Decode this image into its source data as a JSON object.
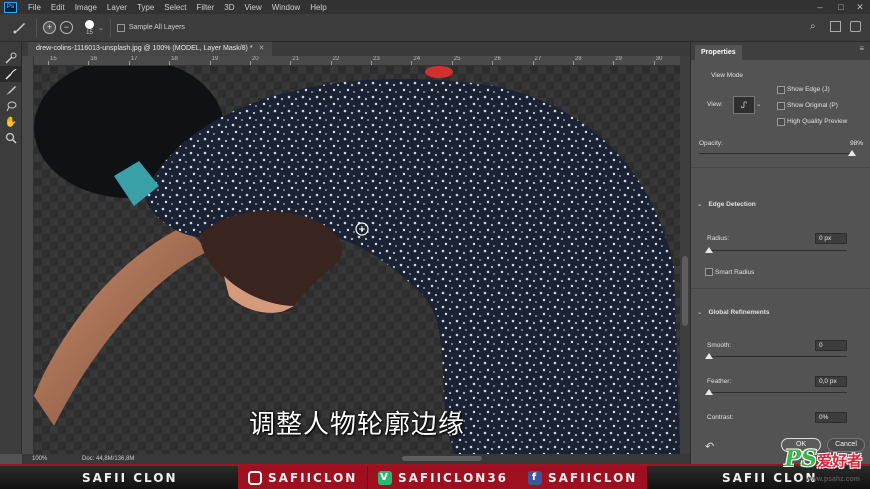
{
  "app": {
    "logo": "Ps"
  },
  "menu": [
    "File",
    "Edit",
    "Image",
    "Layer",
    "Type",
    "Select",
    "Filter",
    "3D",
    "View",
    "Window",
    "Help"
  ],
  "options_bar": {
    "brush_size": "15",
    "sample_all_layers_label": "Sample All Layers"
  },
  "document": {
    "tab_title": "drew-colins-1116013-unsplash.jpg @ 100% (MODEL, Layer Mask/8) *"
  },
  "ruler": {
    "top_ticks": [
      "15",
      "16",
      "17",
      "18",
      "19",
      "20",
      "21",
      "22",
      "23",
      "24",
      "25",
      "26",
      "27",
      "28",
      "29",
      "30"
    ]
  },
  "canvas": {
    "caption": "调整人物轮廓边缘"
  },
  "status": {
    "zoom": "100%",
    "doc_info": "Doc: 44,8M/136,8M"
  },
  "properties": {
    "tab_label": "Properties",
    "view_mode_label": "View Mode",
    "view_label": "View:",
    "show_edge_label": "Show Edge (J)",
    "show_original_label": "Show Original (P)",
    "high_quality_preview_label": "High Quality Preview",
    "opacity_label": "Opacity:",
    "opacity_value": "98%",
    "opacity_level": 0.98,
    "edge_detection_label": "Edge Detection",
    "radius_label": "Radius:",
    "radius_value": "0 px",
    "smart_radius_label": "Smart Radius",
    "global_refinements_label": "Global Refinements",
    "smooth_label": "Smooth:",
    "smooth_value": "0",
    "feather_label": "Feather:",
    "feather_value": "0,0 px",
    "contrast_label": "Contrast:",
    "contrast_value": "0%",
    "ok_label": "OK",
    "cancel_label": "Cancel"
  },
  "banner": {
    "left_brand": "SAFII CLON",
    "instagram": "SAFIICLON",
    "vine": "SAFIICLON36",
    "facebook": "SAFIICLON",
    "right_brand": "SAFII CLON"
  },
  "watermark": {
    "logo": "PS",
    "text": "爱好者",
    "url": "www.psahz.com"
  },
  "colors": {
    "accent_red": "#9e1020",
    "ui_dark": "#323232",
    "panel": "#535353",
    "watermark_green": "#3ab54a"
  }
}
